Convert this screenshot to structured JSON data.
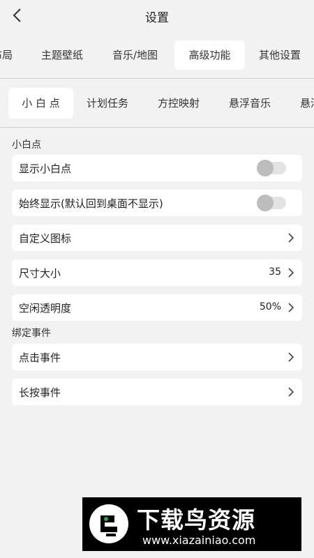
{
  "header": {
    "title": "设置"
  },
  "tabs1": [
    "布局",
    "主题壁纸",
    "音乐/地图",
    "高级功能",
    "其他设置"
  ],
  "tabs2": [
    "小 白 点",
    "计划任务",
    "方控映射",
    "悬浮音乐",
    "悬浮"
  ],
  "section_dot": "小白点",
  "rows": {
    "show_dot": {
      "label": "显示小白点",
      "on": false
    },
    "always_show": {
      "label": "始终显示(默认回到桌面不显示)",
      "on": false
    },
    "custom_icon": {
      "label": "自定义图标"
    },
    "size": {
      "label": "尺寸大小",
      "value": "35"
    },
    "idle_opacity": {
      "label": "空闲透明度",
      "value": "50%"
    }
  },
  "section_bind": "绑定事件",
  "events": {
    "click": {
      "label": "点击事件"
    },
    "long_press": {
      "label": "长按事件"
    }
  },
  "watermark": {
    "brand": "下载鸟资源",
    "url": "www.xiazainiao.com"
  },
  "colors": {
    "background": "#f2f2f2",
    "card": "#ffffff",
    "toggle_off": "#bdbdbd"
  }
}
